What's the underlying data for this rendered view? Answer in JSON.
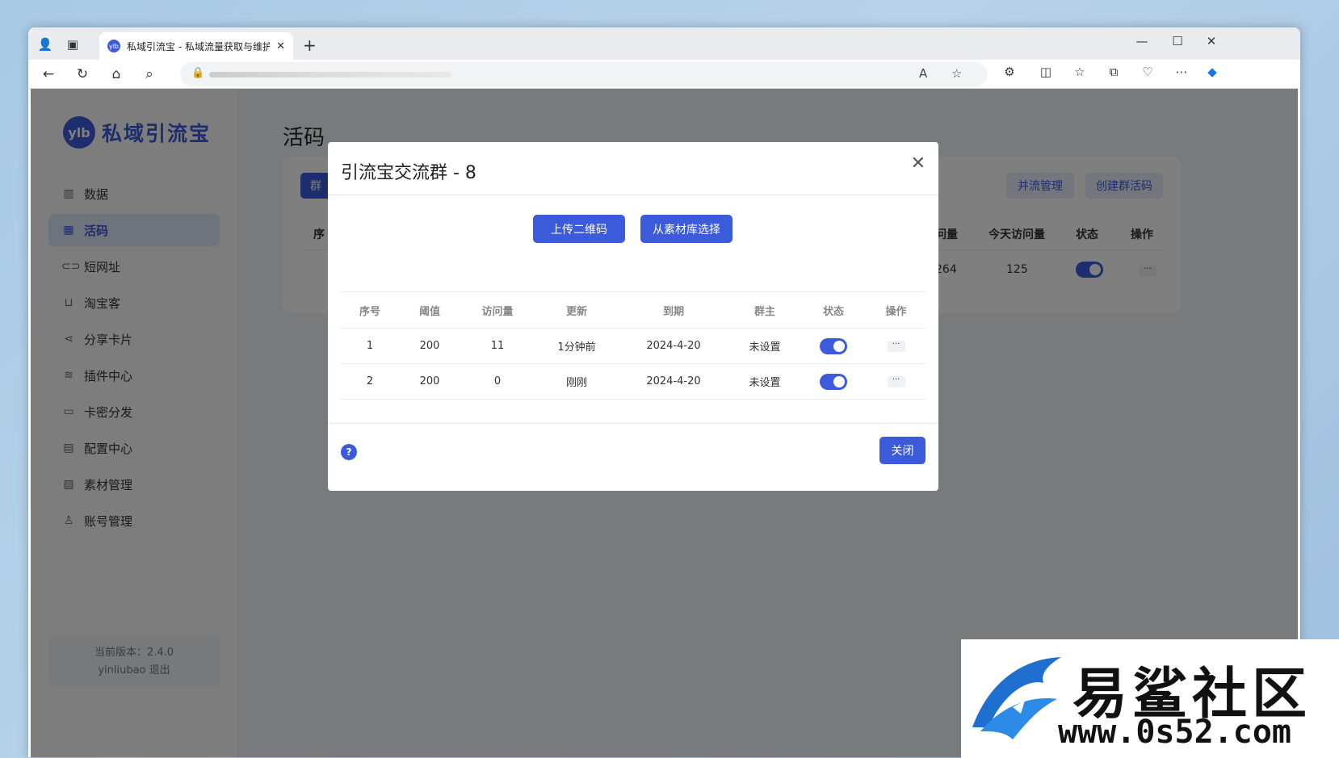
{
  "browser": {
    "tab_title": "私域引流宝 - 私域流量获取与维护",
    "favicon_label": "ylb"
  },
  "sidebar": {
    "logo_mark": "ylb",
    "logo_text": "私域引流宝",
    "items": [
      {
        "label": "数据",
        "icon": "chart-icon",
        "glyph": "▥"
      },
      {
        "label": "活码",
        "icon": "grid-icon",
        "glyph": "▦"
      },
      {
        "label": "短网址",
        "icon": "link-icon",
        "glyph": "⊂⊃"
      },
      {
        "label": "淘宝客",
        "icon": "cart-icon",
        "glyph": "⊔"
      },
      {
        "label": "分享卡片",
        "icon": "share-icon",
        "glyph": "⋖"
      },
      {
        "label": "插件中心",
        "icon": "layers-icon",
        "glyph": "≋"
      },
      {
        "label": "卡密分发",
        "icon": "card-icon",
        "glyph": "▭"
      },
      {
        "label": "配置中心",
        "icon": "config-icon",
        "glyph": "▤"
      },
      {
        "label": "素材管理",
        "icon": "image-icon",
        "glyph": "▨"
      },
      {
        "label": "账号管理",
        "icon": "user-icon",
        "glyph": "♙"
      }
    ],
    "version_text": "当前版本：2.4.0",
    "username": "yinliubao",
    "logout": "退出"
  },
  "main": {
    "title": "活码",
    "tab_label": "群",
    "merge_button": "并流管理",
    "create_button": "创建群活码",
    "headers": {
      "seq": "序",
      "visits": "问量",
      "today": "今天访问量",
      "status": "状态",
      "action": "操作"
    },
    "row": {
      "visits": "264",
      "today": "125"
    }
  },
  "modal": {
    "title": "引流宝交流群 - 8",
    "upload_button": "上传二维码",
    "library_button": "从素材库选择",
    "headers": [
      "序号",
      "阈值",
      "访问量",
      "更新",
      "到期",
      "群主",
      "状态",
      "操作"
    ],
    "rows": [
      {
        "seq": "1",
        "threshold": "200",
        "visits": "11",
        "updated": "1分钟前",
        "expires": "2024-4-20",
        "owner": "未设置",
        "enabled": true
      },
      {
        "seq": "2",
        "threshold": "200",
        "visits": "0",
        "updated": "刚刚",
        "expires": "2024-4-20",
        "owner": "未设置",
        "enabled": true
      }
    ],
    "help": "?",
    "close_button": "关闭"
  },
  "watermark": {
    "name": "易鲨社区",
    "site": "www.0s52.com"
  }
}
